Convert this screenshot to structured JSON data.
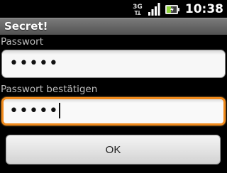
{
  "status_bar": {
    "time": "10:38",
    "icons": [
      "3g-data-icon",
      "signal-strength-icon",
      "battery-charging-icon"
    ],
    "network_type": "3G"
  },
  "dialog": {
    "title": "Secret!"
  },
  "form": {
    "password_label": "Passwort",
    "password_value": "•••••",
    "confirm_label": "Passwort bestätigen",
    "confirm_value": "•••••"
  },
  "buttons": {
    "ok_label": "OK"
  },
  "colors": {
    "focus_border": "#f08a1c",
    "background": "#000000",
    "title_bar": "#6a6a6a",
    "battery_accent": "#8fd43a"
  }
}
